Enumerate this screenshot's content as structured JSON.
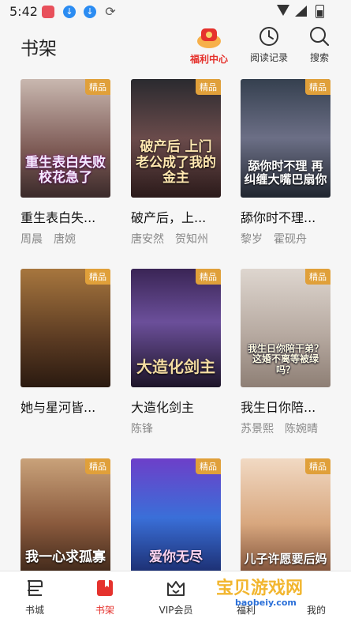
{
  "status_bar": {
    "time": "5:42"
  },
  "header": {
    "title": "书架",
    "welfare_label": "福利中心",
    "history_label": "阅读记录",
    "search_label": "搜索"
  },
  "books": [
    {
      "title": "重生表白失...",
      "authors": "周晨　唐婉",
      "badge": "精品",
      "cover_text": "重生表白失败 校花急了"
    },
    {
      "title": "破产后，上...",
      "authors": "唐安然　贺知州",
      "badge": "精品",
      "cover_text": "破产后 上门老公成了我的金主"
    },
    {
      "title": "舔你时不理...",
      "authors": "黎岁　霍砚舟",
      "badge": "精品",
      "cover_text": "舔你时不理 再纠缠大嘴巴扇你"
    },
    {
      "title": "她与星河皆...",
      "authors": "",
      "badge": "精品",
      "cover_text": ""
    },
    {
      "title": "大造化剑主",
      "authors": "陈锋",
      "badge": "精品",
      "cover_text": "大造化剑主"
    },
    {
      "title": "我生日你陪...",
      "authors": "苏景熙　陈婉晴",
      "badge": "精品",
      "cover_text": "我生日你陪干弟？这婚不离等被绿吗？"
    },
    {
      "title": "",
      "authors": "",
      "badge": "精品",
      "cover_text": "我一心求孤寡"
    },
    {
      "title": "",
      "authors": "",
      "badge": "精品",
      "cover_text": "爱你无尽"
    },
    {
      "title": "",
      "authors": "",
      "badge": "精品",
      "cover_text": "儿子许愿要后妈"
    }
  ],
  "tabs": [
    {
      "label": "书城"
    },
    {
      "label": "书架"
    },
    {
      "label": "VIP会员"
    },
    {
      "label": "福利"
    },
    {
      "label": "我的"
    }
  ],
  "watermark": {
    "text": "宝贝游戏网",
    "url": "baobeiy.com"
  },
  "colors": {
    "accent": "#e5322d",
    "badge": "#e0a03a"
  }
}
